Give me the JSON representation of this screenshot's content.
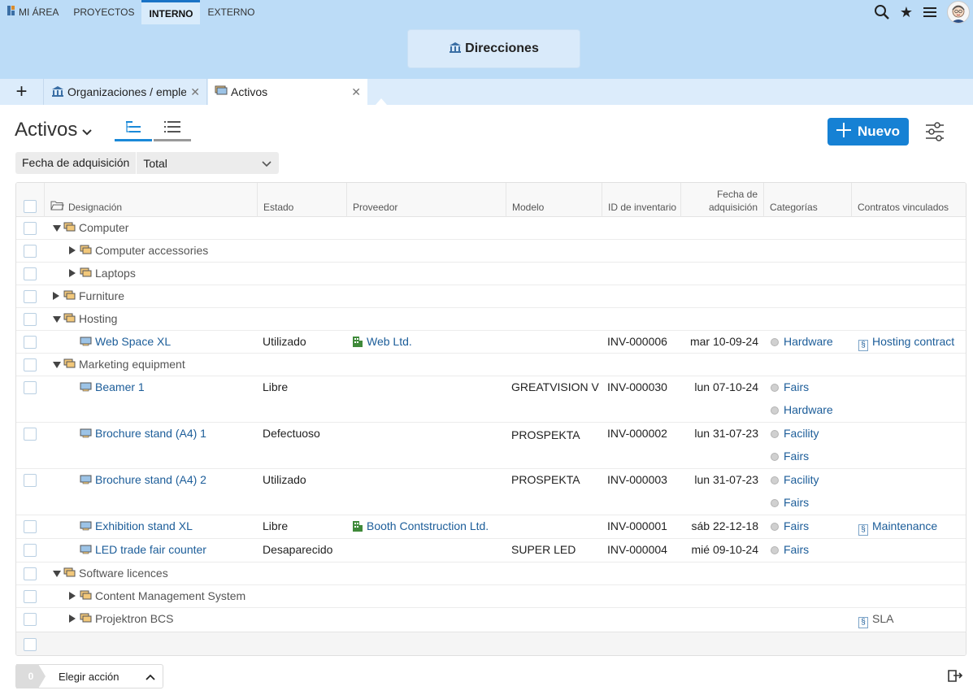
{
  "nav": {
    "items": [
      {
        "label": "MI ÁREA",
        "icon": "my-area-icon"
      },
      {
        "label": "PROYECTOS"
      },
      {
        "label": "INTERNO",
        "active": true
      },
      {
        "label": "EXTERNO"
      }
    ]
  },
  "header": {
    "section_button": "Direcciones"
  },
  "tabs": [
    {
      "label": "Organizaciones / empleados"
    },
    {
      "label": "Activos"
    }
  ],
  "page": {
    "title": "Activos"
  },
  "toolbar": {
    "new_label": "Nuevo"
  },
  "filter": {
    "label": "Fecha de adquisición",
    "value": "Total"
  },
  "columns": {
    "designation": "Designación",
    "status": "Estado",
    "supplier": "Proveedor",
    "model": "Modelo",
    "inventory_id": "ID de inventario",
    "acq_date_1": "Fecha de",
    "acq_date_2": "adquisición",
    "categories": "Categorías",
    "contracts": "Contratos vinculados"
  },
  "rows": {
    "r0": {
      "name": "Computer"
    },
    "r1": {
      "name": "Computer accessories"
    },
    "r2": {
      "name": "Laptops"
    },
    "r3": {
      "name": "Furniture"
    },
    "r4": {
      "name": "Hosting"
    },
    "r5": {
      "name": "Web Space XL",
      "status": "Utilizado",
      "supplier": "Web Ltd.",
      "inv": "INV-000006",
      "date": "mar 10-09-24",
      "cat1": "Hardware",
      "contract": "Hosting contract"
    },
    "r6": {
      "name": "Marketing equipment"
    },
    "r7": {
      "name": "Beamer 1",
      "status": "Libre",
      "model": "GREATVISION V",
      "inv": "INV-000030",
      "date": "lun 07-10-24",
      "cat1": "Fairs",
      "cat2": "Hardware"
    },
    "r8": {
      "name": "Brochure stand (A4) 1",
      "status": "Defectuoso",
      "model": "PROSPEKTA",
      "inv": "INV-000002",
      "date": "lun 31-07-23",
      "cat1": "Facility",
      "cat2": "Fairs"
    },
    "r9": {
      "name": "Brochure stand (A4) 2",
      "status": "Utilizado",
      "model": "PROSPEKTA",
      "inv": "INV-000003",
      "date": "lun 31-07-23",
      "cat1": "Facility",
      "cat2": "Fairs"
    },
    "r10": {
      "name": "Exhibition stand XL",
      "status": "Libre",
      "supplier": "Booth Contstruction Ltd.",
      "inv": "INV-000001",
      "date": "sáb 22-12-18",
      "cat1": "Fairs",
      "contract": "Maintenance"
    },
    "r11": {
      "name": "LED trade fair counter",
      "status": "Desaparecido",
      "model": "SUPER LED",
      "inv": "INV-000004",
      "date": "mié 09-10-24",
      "cat1": "Fairs"
    },
    "r12": {
      "name": "Software licences"
    },
    "r13": {
      "name": "Content Management System"
    },
    "r14": {
      "name": "Projektron BCS",
      "contract": "SLA"
    }
  },
  "footer": {
    "count": "0",
    "action_label": "Elegir acción"
  },
  "colors": {
    "accent": "#1681d4",
    "header_bg": "#bcdcf7",
    "link": "#1c5d99"
  }
}
